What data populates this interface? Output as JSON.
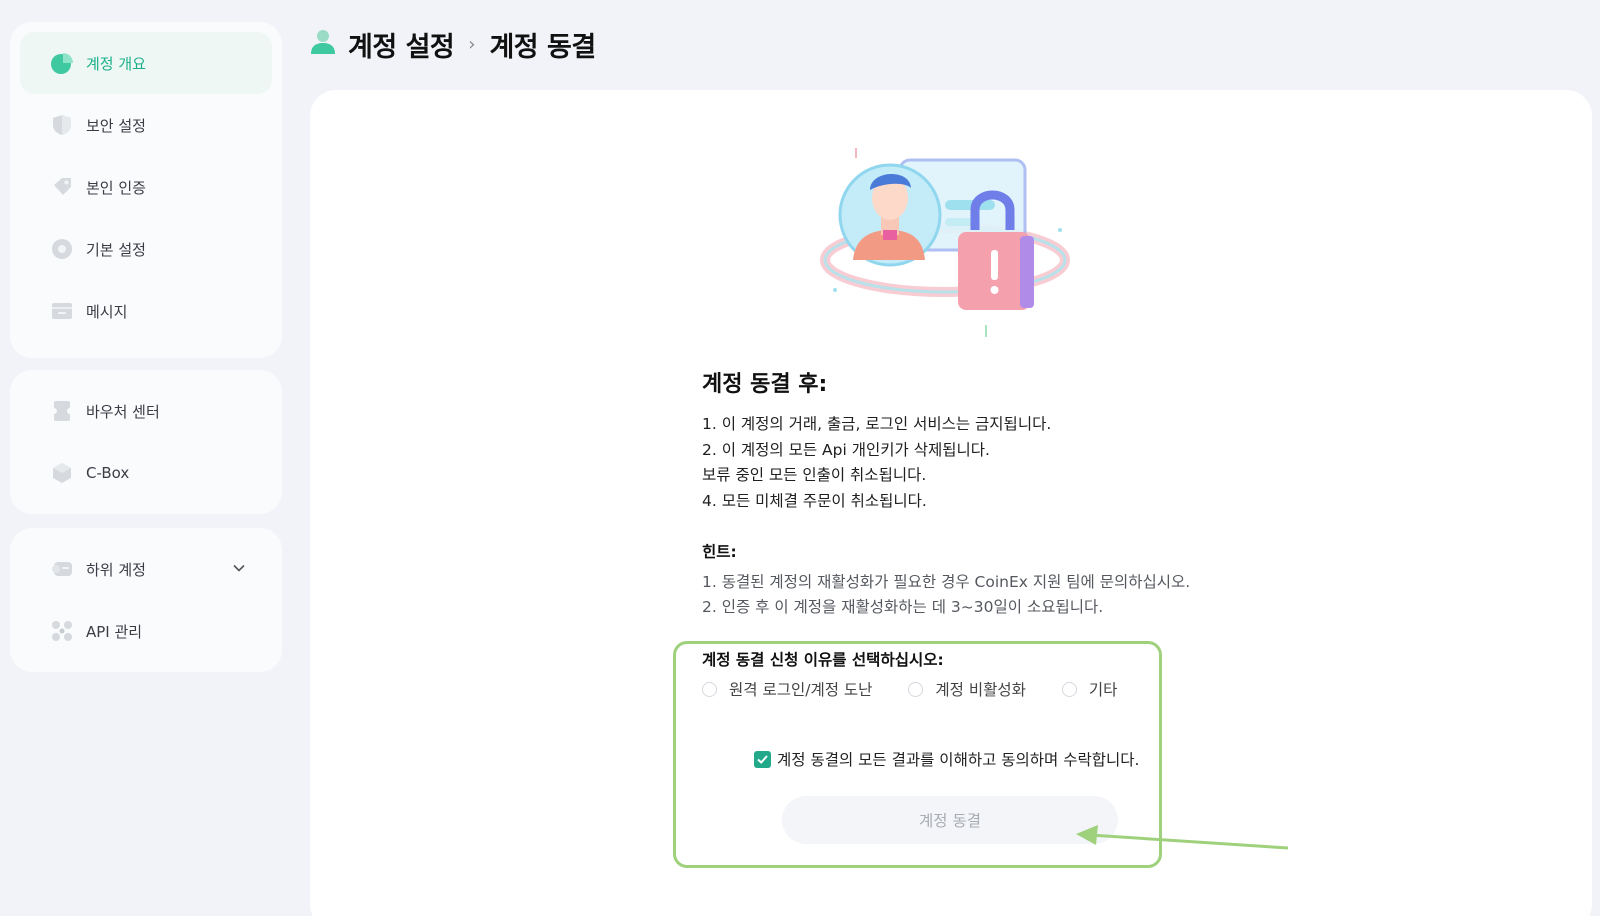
{
  "sidebar": {
    "group1": [
      {
        "label": "계정 개요",
        "icon": "pie-chart-icon",
        "active": true
      },
      {
        "label": "보안 설정",
        "icon": "shield-icon"
      },
      {
        "label": "본인 인증",
        "icon": "id-tag-icon"
      },
      {
        "label": "기본 설정",
        "icon": "settings-gear-icon"
      },
      {
        "label": "메시지",
        "icon": "message-card-icon"
      }
    ],
    "group2": [
      {
        "label": "바우처 센터",
        "icon": "voucher-icon"
      },
      {
        "label": "C-Box",
        "icon": "gift-box-icon"
      }
    ],
    "group3": [
      {
        "label": "하위 계정",
        "icon": "sub-account-icon",
        "has_dropdown": true
      },
      {
        "label": "API 관리",
        "icon": "api-nodes-icon"
      }
    ]
  },
  "header": {
    "crumb_parent": "계정 설정",
    "crumb_current": "계정 동결",
    "separator": "›"
  },
  "main": {
    "illustration": "locked-account-illustration",
    "title": "계정 동결 후:",
    "rules": [
      "1. 이 계정의 거래, 출금, 로그인 서비스는 금지됩니다.",
      "2. 이 계정의 모든 Api 개인키가 삭제됩니다.",
      "보류 중인 모든 인출이 취소됩니다.",
      "4. 모든 미체결 주문이 취소됩니다."
    ],
    "hint_title": "힌트:",
    "hints": [
      "1. 동결된 계정의 재활성화가 필요한 경우 CoinEx 지원 팀에 문의하십시오.",
      "2. 인증 후 이 계정을 재활성화하는 데 3~30일이 소요됩니다."
    ],
    "reason_title": "계정 동결 신청 이유를 선택하십시오:",
    "reasons": [
      "원격 로그인/계정 도난",
      "계정 비활성화",
      "기타"
    ],
    "agree_label": "계정 동결의 모든 결과를 이해하고 동의하며 수락합니다.",
    "agree_checked": true,
    "submit_label": "계정 동결"
  },
  "colors": {
    "accent": "#22a98a",
    "highlight": "#9fd17d",
    "button_bg": "#f3f5f8",
    "button_text": "#a7abb2"
  }
}
